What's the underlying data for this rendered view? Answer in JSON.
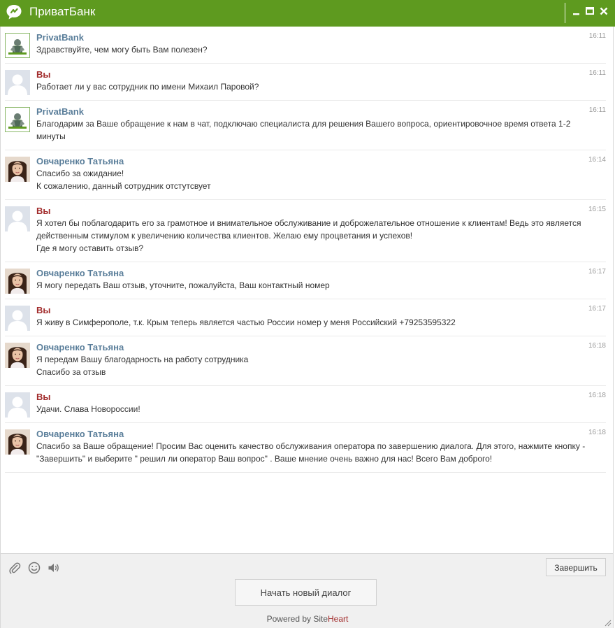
{
  "window": {
    "title": "ПриватБанк",
    "controls": [
      "minimize-icon",
      "maximize-icon",
      "close-icon"
    ]
  },
  "colors": {
    "titlebar": "#5e9a1f",
    "bot_name": "#5a7e9a",
    "user_name": "#a12a2a",
    "operator_name": "#5a7e9a"
  },
  "messages": [
    {
      "author": "PrivatBank",
      "role": "bot",
      "time": "16:11",
      "lines": [
        "Здравствуйте, чем могу быть Вам полезен?"
      ]
    },
    {
      "author": "Вы",
      "role": "you",
      "time": "16:11",
      "lines": [
        "Работает ли у вас сотрудник по имени Михаил Паровой?"
      ]
    },
    {
      "author": "PrivatBank",
      "role": "bot",
      "time": "16:11",
      "lines": [
        "Благодарим за Ваше обращение к нам в чат, подключаю специалиста для решения Вашего вопроса, ориентировочное время ответа 1-2 минуты"
      ]
    },
    {
      "author": "Овчаренко Татьяна",
      "role": "op",
      "time": "16:14",
      "lines": [
        "Спасибо за ожидание!",
        "К сожалению, данный сотрудник отстутсвует"
      ]
    },
    {
      "author": "Вы",
      "role": "you",
      "time": "16:15",
      "lines": [
        "Я хотел бы поблагодарить его за грамотное и внимательное обслуживание и доброжелательное отношение к клиентам! Ведь это является действенным стимулом к увеличению количества клиентов. Желаю ему процветания и успехов!",
        "Где я могу оставить отзыв?"
      ]
    },
    {
      "author": "Овчаренко Татьяна",
      "role": "op",
      "time": "16:17",
      "lines": [
        "Я могу передать Ваш отзыв, уточните, пожалуйста, Ваш контактный номер"
      ]
    },
    {
      "author": "Вы",
      "role": "you",
      "time": "16:17",
      "lines": [
        "Я живу в Симферополе, т.к. Крым теперь является частью России номер у меня Российский +79253595322"
      ]
    },
    {
      "author": "Овчаренко Татьяна",
      "role": "op",
      "time": "16:18",
      "lines": [
        "Я передам Вашу благодарность на работу сотрудника",
        "Спасибо за отзыв"
      ]
    },
    {
      "author": "Вы",
      "role": "you",
      "time": "16:18",
      "lines": [
        "Удачи. Слава Новороссии!"
      ]
    },
    {
      "author": "Овчаренко Татьяна",
      "role": "op",
      "time": "16:18",
      "lines": [
        "Спасибо за Ваше обращение! Просим Вас оценить качество обслуживания оператора по завершению диалога. Для этого, нажмите кнопку - \"Завершить\" и выберите \" решил ли оператор Ваш вопрос\" . Ваше мнение очень важно для нас! Всего Вам доброго!"
      ]
    }
  ],
  "toolbar": {
    "icons": [
      "paperclip-icon",
      "smiley-icon",
      "sound-icon"
    ],
    "finish_label": "Завершить"
  },
  "new_dialog_label": "Начать новый диалог",
  "footer": {
    "powered_prefix": "Powered by ",
    "brand_site": "Site",
    "brand_heart": "Heart"
  }
}
